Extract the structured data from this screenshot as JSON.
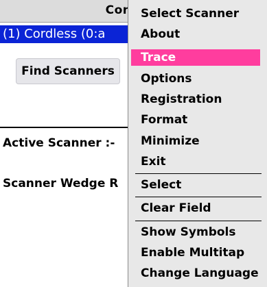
{
  "app": {
    "title": "Conn",
    "selected_scanner": "(1) Cordless (0:a",
    "find_button": "Find Scanners",
    "active_scanner_label": "Active Scanner :-",
    "wedge_label": "Scanner Wedge R"
  },
  "menu": {
    "items": [
      {
        "label": "Select Scanner",
        "highlighted": false
      },
      {
        "label": "About",
        "highlighted": false
      },
      {
        "label": "Trace",
        "highlighted": true
      },
      {
        "label": "Options",
        "highlighted": false
      },
      {
        "label": "Registration",
        "highlighted": false
      },
      {
        "label": "Format",
        "highlighted": false
      },
      {
        "label": "Minimize",
        "highlighted": false
      },
      {
        "label": "Exit",
        "highlighted": false
      },
      {
        "label": "Select",
        "highlighted": false
      },
      {
        "label": "Clear Field",
        "highlighted": false
      },
      {
        "label": "Show Symbols",
        "highlighted": false
      },
      {
        "label": "Enable Multitap",
        "highlighted": false
      },
      {
        "label": "Change Language",
        "highlighted": false
      }
    ],
    "highlight_color": "#ff3d9e",
    "background_color": "#e8e8e8"
  },
  "colors": {
    "selection_blue": "#0b24d6"
  }
}
